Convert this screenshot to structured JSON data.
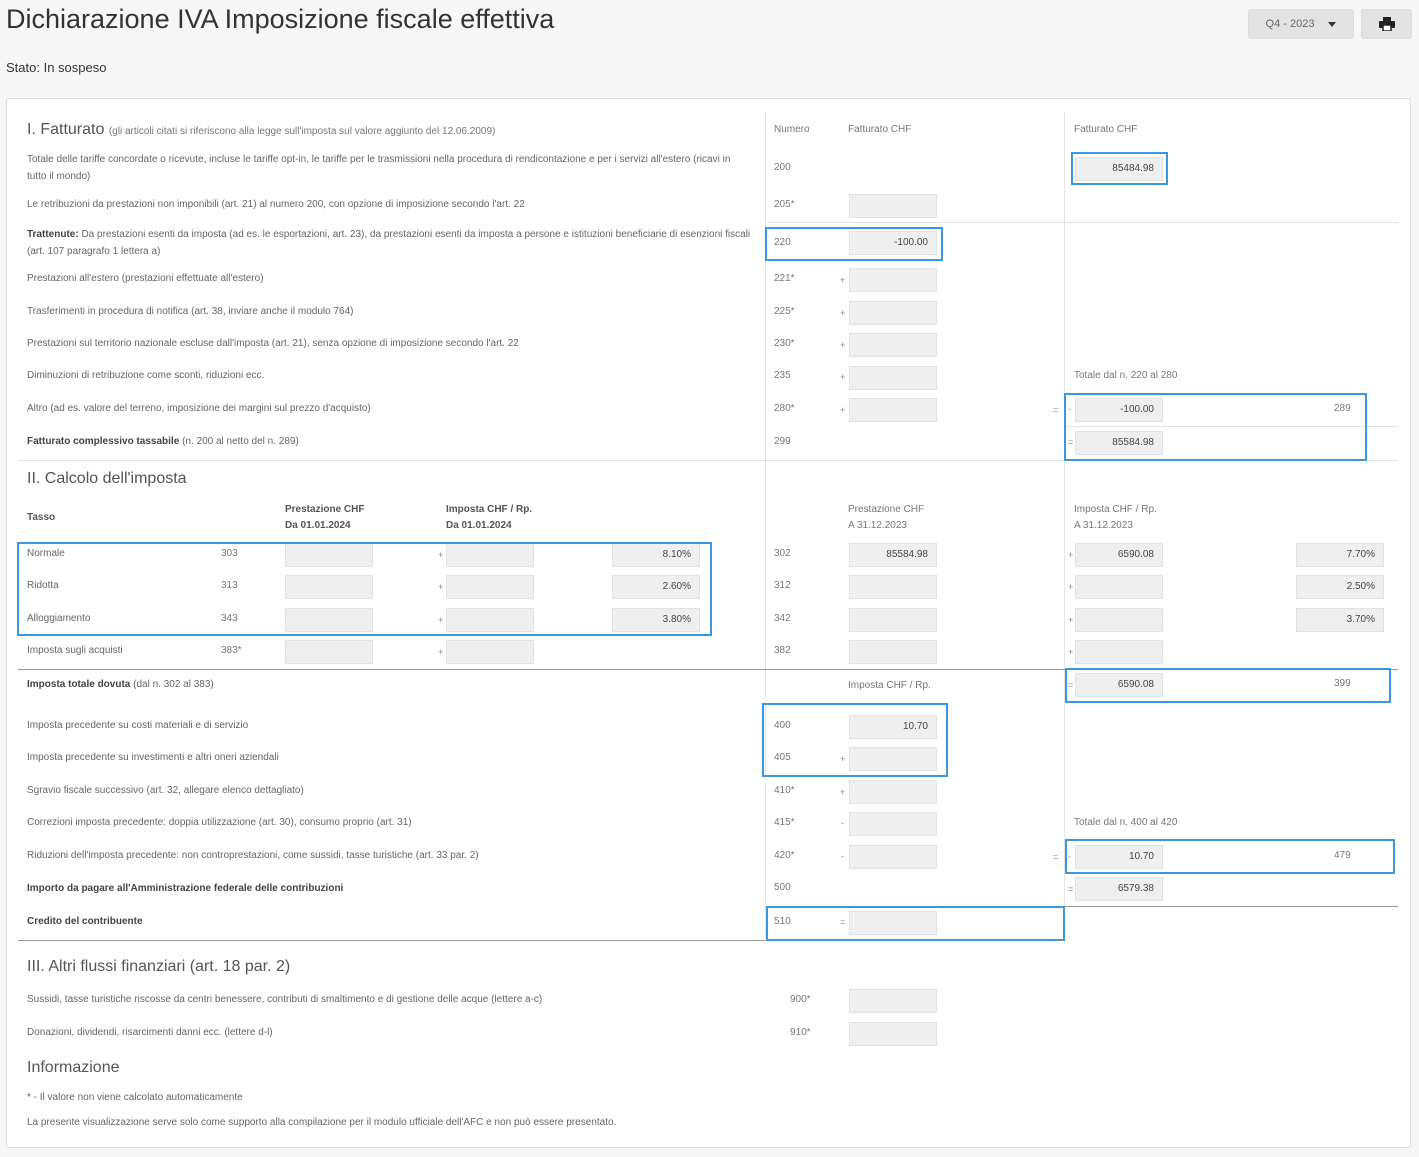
{
  "header": {
    "title": "Dichiarazione IVA Imposizione fiscale effettiva",
    "status": "Stato: In sospeso",
    "period": "Q4 - 2023"
  },
  "fatturato": {
    "title": "I. Fatturato",
    "subtitle": "(gli articoli citati si riferiscono alla legge sull'imposta sul valore aggiunto del 12.06.2009)",
    "col_numero": "Numero",
    "col_fatturato": "Fatturato CHF",
    "col_fatturato2": "Fatturato CHF",
    "rows": [
      {
        "label": "Totale delle tariffe concordate o ricevute, incluse le tariffe opt-in, le tariffe per le trasmissioni nella procedura di rendicontazione e per i servizi all'estero (ricavi in tutto il mondo)",
        "num": "200",
        "value": "85484.98"
      },
      {
        "label": "Le retribuzioni da prestazioni non imponibili (art. 21) al numero 200, con opzione di imposizione secondo l'art. 22",
        "num": "205*",
        "value": ""
      },
      {
        "label_bold": "Trattenute:",
        "label": " Da prestazioni esenti da imposta (ad es. le esportazioni, art. 23), da prestazioni esenti da imposta a persone e istituzioni beneficiarie di esenzioni fiscali (art. 107 paragrafo 1 lettera a)",
        "num": "220",
        "value": "-100.00"
      },
      {
        "label": "Prestazioni all'estero (prestazioni effettuate all'estero)",
        "num": "221*",
        "sign": "+",
        "value": ""
      },
      {
        "label": "Trasferimenti in procedura di notifica (art. 38, inviare anche il modulo 764)",
        "num": "225*",
        "sign": "+",
        "value": ""
      },
      {
        "label": "Prestazioni sul territorio nazionale escluse dall'imposta (art. 21), senza opzione di imposizione secondo l'art. 22",
        "num": "230*",
        "sign": "+",
        "value": ""
      },
      {
        "label": "Diminuzioni di retribuzione come sconti, riduzioni ecc.",
        "num": "235",
        "sign": "+",
        "value": ""
      },
      {
        "label": "Altro (ad es. valore del terreno, imposizione dei margini sul prezzo d'acquisto)",
        "num": "280*",
        "sign": "+",
        "value": ""
      }
    ],
    "totale_label": "Totale dal n. 220 al 280",
    "eq": "=",
    "minus": "-",
    "totale_value": "-100.00",
    "totale_num": "289",
    "complessivo_label": "Fatturato complessivo tassabile",
    "complessivo_sub": "(n. 200 al netto del n. 289)",
    "complessivo_num": "299",
    "complessivo_value": "85584.98"
  },
  "calcolo": {
    "title": "II. Calcolo dell'imposta",
    "tasso": "Tasso",
    "col_prest_new_1": "Prestazione CHF",
    "col_prest_new_2": "Da 01.01.2024",
    "col_imp_new_1": "Imposta CHF / Rp.",
    "col_imp_new_2": "Da 01.01.2024",
    "col_prest_old_1": "Prestazione CHF",
    "col_prest_old_2": "A 31.12.2023",
    "col_imp_old_1": "Imposta CHF / Rp.",
    "col_imp_old_2": "A 31.12.2023",
    "plus": "+",
    "rates": [
      {
        "label": "Normale",
        "num_new": "303",
        "rate_new": "8.10%",
        "num_old": "302",
        "prest_old": "85584.98",
        "imp_old": "6590.08",
        "rate_old": "7.70%"
      },
      {
        "label": "Ridotta",
        "num_new": "313",
        "rate_new": "2.60%",
        "num_old": "312",
        "prest_old": "",
        "imp_old": "",
        "rate_old": "2.50%"
      },
      {
        "label": "Alloggiamento",
        "num_new": "343",
        "rate_new": "3.80%",
        "num_old": "342",
        "prest_old": "",
        "imp_old": "",
        "rate_old": "3.70%"
      }
    ],
    "acquisti_label": "Imposta sugli acquisti",
    "acquisti_num": "383*",
    "acquisti_num_old": "382",
    "totale_label": "Imposta totale dovuta",
    "totale_sub": "(dal n. 302 al 383)",
    "totale_col": "Imposta CHF / Rp.",
    "totale_value": "6590.08",
    "totale_num": "399",
    "eq": "=",
    "minus": "-",
    "pre_rows": [
      {
        "label": "Imposta precedente su costi materiali e di servizio",
        "num": "400",
        "sign": "",
        "value": "10.70"
      },
      {
        "label": "Imposta precedente su investimenti e altri oneri aziendali",
        "num": "405",
        "sign": "+",
        "value": ""
      },
      {
        "label": "Sgravio fiscale successivo (art. 32, allegare elenco dettagliato)",
        "num": "410*",
        "sign": "+",
        "value": ""
      },
      {
        "label": "Correzioni imposta precedente: doppia utilizzazione (art. 30), consumo proprio (art. 31)",
        "num": "415*",
        "sign": "-",
        "value": ""
      },
      {
        "label": "Riduzioni dell'imposta precedente: non controprestazioni, come sussidi, tasse turistiche (art. 33 par. 2)",
        "num": "420*",
        "sign": "-",
        "value": ""
      }
    ],
    "pre_totale_label": "Totale dal n. 400 al 420",
    "pre_totale_value": "10.70",
    "pre_totale_num": "479",
    "importo_label": "Importo da pagare all'Amministrazione federale delle contribuzioni",
    "importo_num": "500",
    "importo_value": "6579.38",
    "credito_label": "Credito del contribuente",
    "credito_num": "510",
    "credito_value": ""
  },
  "altri": {
    "title": "III. Altri flussi finanziari (art. 18 par. 2)",
    "rows": [
      {
        "label": "Sussidi, tasse turistiche riscosse da centri benessere, contributi di smaltimento e di gestione delle acque (lettere a-c)",
        "num": "900*",
        "value": ""
      },
      {
        "label": "Donazioni, dividendi, risarcimenti danni ecc. (lettere d-l)",
        "num": "910*",
        "value": ""
      }
    ]
  },
  "info": {
    "title": "Informazione",
    "note1": "* - Il valore non viene calcolato automaticamente",
    "note2": "La presente visualizzazione serve solo come supporto alla compilazione per il modulo ufficiale dell'AFC e non può essere presentato."
  },
  "icons": {
    "print": "printer-icon",
    "dropdown": "caret-down-icon"
  },
  "colors": {
    "highlight": "#3a97e0",
    "input_bg": "#efefef"
  }
}
